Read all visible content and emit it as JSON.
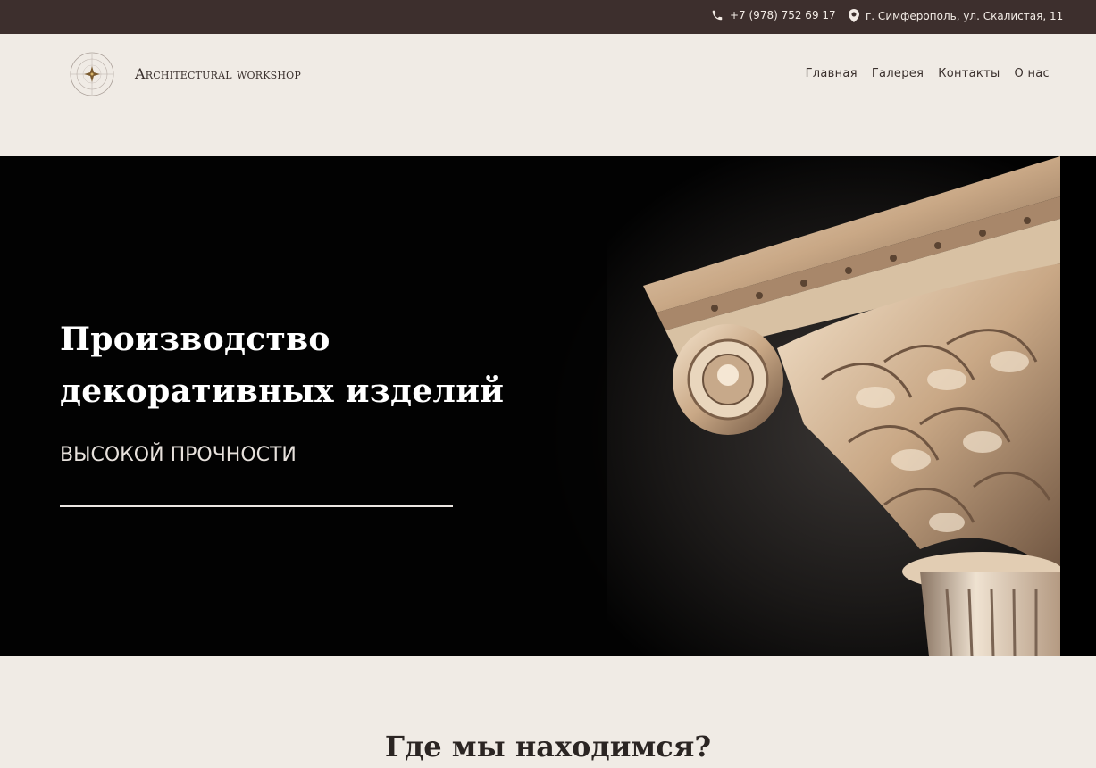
{
  "topbar": {
    "phone": "+7 (978) 752 69 17",
    "address": "г. Симферополь, ул. Скалистая, 11",
    "phone_icon": "phone-icon",
    "address_icon": "map-marker-icon"
  },
  "header": {
    "brand": "Architectural workshop",
    "logo_icon": "compass-star-logo",
    "nav": [
      {
        "label": "Главная"
      },
      {
        "label": "Галерея"
      },
      {
        "label": "Контакты"
      },
      {
        "label": "О нас"
      }
    ]
  },
  "hero": {
    "title": "Производство декоративных изделий",
    "subtitle": "ВЫСОКОЙ ПРОЧНОСТИ"
  },
  "location": {
    "title": "Где мы находимся?"
  },
  "colors": {
    "topbar_bg": "#3d2f2d",
    "page_bg": "#f0ebe5",
    "hero_bg": "#020202",
    "text_dark": "#3a302d"
  }
}
